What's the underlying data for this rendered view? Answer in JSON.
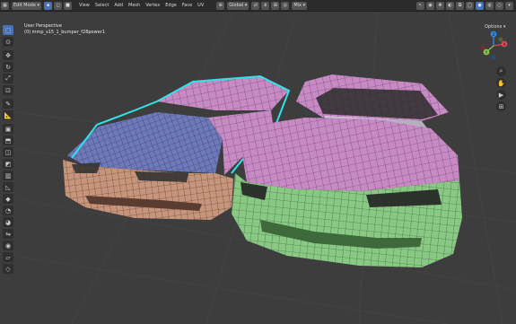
{
  "header": {
    "mode_label": "Edit Mode",
    "menus": [
      "View",
      "Select",
      "Add",
      "Mesh",
      "Vertex",
      "Edge",
      "Face",
      "UV"
    ],
    "transform_orientation": "Global",
    "proportional_label": "Mix",
    "options_label": "Options"
  },
  "viewport": {
    "view_name": "User Perspective",
    "object_name": "(0) mmp_s15_1_bumper_f28power1"
  },
  "gizmo": {
    "x": "X",
    "y": "Y",
    "z": "Z"
  },
  "icons": {
    "nav_zoom": "zoom-icon",
    "nav_pan": "hand-icon",
    "nav_camera": "camera-icon",
    "nav_grid": "grid-icon"
  },
  "colors": {
    "accent": "#4772b3",
    "mesh_orange": "#c7957b",
    "mesh_pink": "#c88ac4",
    "mesh_blue": "#6d79b8",
    "mesh_green": "#89c985",
    "selection_cyan": "#2fe3e6"
  }
}
